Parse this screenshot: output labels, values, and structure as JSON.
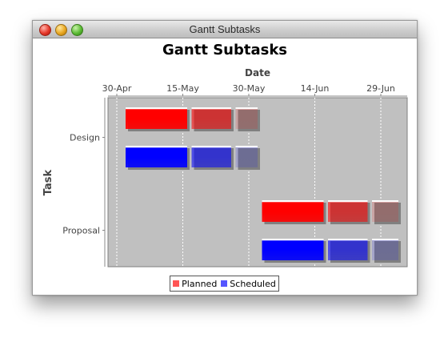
{
  "window": {
    "title": "Gantt Subtasks"
  },
  "chart_data": {
    "type": "gantt",
    "title": "Gantt Subtasks",
    "xlabel": "Date",
    "ylabel": "Task",
    "x_axis_position": "top",
    "xlim": [
      "2010-04-28",
      "2010-07-05"
    ],
    "x_ticks": [
      {
        "date": "2010-04-30",
        "label": "30-Apr"
      },
      {
        "date": "2010-05-15",
        "label": "15-May"
      },
      {
        "date": "2010-05-30",
        "label": "30-May"
      },
      {
        "date": "2010-06-14",
        "label": "14-Jun"
      },
      {
        "date": "2010-06-29",
        "label": "29-Jun"
      }
    ],
    "grid": true,
    "legend_position": "bottom",
    "categories": [
      "Design",
      "Proposal"
    ],
    "series": [
      {
        "name": "Planned",
        "color": "#ff0000",
        "tasks": [
          {
            "task": "Design",
            "subtasks": [
              {
                "start": "2010-05-02",
                "end": "2010-05-16"
              },
              {
                "start": "2010-05-17",
                "end": "2010-05-26"
              },
              {
                "start": "2010-05-27",
                "end": "2010-06-01"
              }
            ]
          },
          {
            "task": "Proposal",
            "subtasks": [
              {
                "start": "2010-06-02",
                "end": "2010-06-16"
              },
              {
                "start": "2010-06-17",
                "end": "2010-06-26"
              },
              {
                "start": "2010-06-27",
                "end": "2010-07-03"
              }
            ]
          }
        ]
      },
      {
        "name": "Scheduled",
        "color": "#0000ff",
        "tasks": [
          {
            "task": "Design",
            "subtasks": [
              {
                "start": "2010-05-02",
                "end": "2010-05-16"
              },
              {
                "start": "2010-05-17",
                "end": "2010-05-26"
              },
              {
                "start": "2010-05-27",
                "end": "2010-06-01"
              }
            ]
          },
          {
            "task": "Proposal",
            "subtasks": [
              {
                "start": "2010-06-02",
                "end": "2010-06-16"
              },
              {
                "start": "2010-06-17",
                "end": "2010-06-26"
              },
              {
                "start": "2010-06-27",
                "end": "2010-07-03"
              }
            ]
          }
        ]
      }
    ],
    "plot_background": "#c0c0c0"
  }
}
